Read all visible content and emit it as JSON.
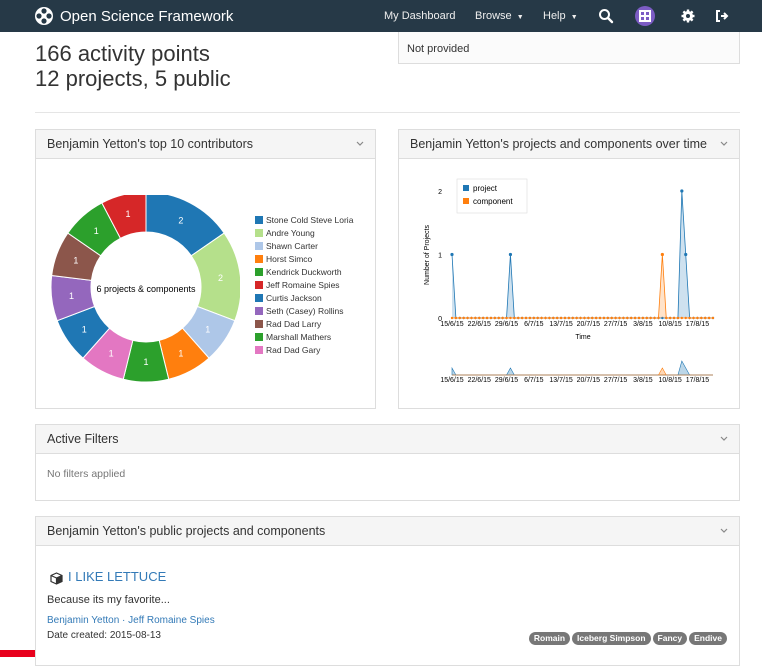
{
  "navbar": {
    "brand": "Open Science Framework",
    "dashboard": "My Dashboard",
    "browse": "Browse",
    "help": "Help"
  },
  "stats": {
    "activity": "166 activity points",
    "projects": "12 projects, 5 public"
  },
  "top_right_value": "Not provided",
  "contributors_panel": {
    "title": "Benjamin Yetton's top 10 contributors",
    "center_label": "6 projects & components"
  },
  "timeline_panel": {
    "title": "Benjamin Yetton's projects and components over time"
  },
  "filters_panel": {
    "title": "Active Filters",
    "empty_text": "No filters applied"
  },
  "public_panel": {
    "title": "Benjamin Yetton's public projects and components"
  },
  "project": {
    "title": "I LIKE LETTUCE",
    "description": "Because its my favorite...",
    "contributors": "Benjamin Yetton · Jeff Romaine Spies",
    "date": "Date created: 2015-08-13",
    "tags": [
      "Romain",
      "Iceberg Simpson",
      "Fancy",
      "Endive"
    ]
  },
  "chart_data": [
    {
      "type": "pie",
      "subtype": "donut",
      "center_label": "6 projects & components",
      "legend_placement": "right",
      "slices": [
        {
          "label": "Stone Cold Steve Loria",
          "value": 2,
          "color": "#1f77b4"
        },
        {
          "label": "Andre Young",
          "value": 2,
          "color": "#aec7e8"
        },
        {
          "label": "Shawn Carter",
          "value": 1,
          "color": "#aec7e8"
        },
        {
          "label": "Horst Simco",
          "value": 1,
          "color": "#ff7f0e"
        },
        {
          "label": "Kendrick Duckworth",
          "value": 1,
          "color": "#2ca02c"
        },
        {
          "label": "Jeff Romaine Spies",
          "value": 1,
          "color": "#d62728"
        },
        {
          "label": "Curtis Jackson",
          "value": 1,
          "color": "#1f77b4"
        },
        {
          "label": "Seth (Casey) Rollins",
          "value": 1,
          "color": "#9467bd"
        },
        {
          "label": "Rad Dad Larry",
          "value": 1,
          "color": "#8c564b"
        },
        {
          "label": "Marshall Mathers",
          "value": 1,
          "color": "#2ca02c"
        },
        {
          "label": "Rad Dad Gary",
          "value": 1,
          "color": "#e377c2"
        }
      ],
      "legend_colors": [
        "#1f77b4",
        "#b5e08b",
        "#aec7e8",
        "#ff7f0e",
        "#2ca02c",
        "#d62728",
        "#1f77b4",
        "#9467bd",
        "#8c564b",
        "#2ca02c",
        "#e377c2"
      ],
      "ring_colors": [
        "#1f77b4",
        "#b5e08b",
        "#aec7e8",
        "#ff7f0e",
        "#2ca02c",
        "#e377c2",
        "#1f77b4",
        "#9467bd",
        "#8c564b",
        "#2ca02c",
        "#d62728"
      ]
    },
    {
      "type": "area",
      "xlabel": "Time",
      "ylabel": "Number of Projects",
      "ylim": [
        0,
        2
      ],
      "yticks": [
        "0",
        "1",
        "2"
      ],
      "x_ticks": [
        "15/6/15",
        "22/6/15",
        "29/6/15",
        "6/7/15",
        "13/7/15",
        "20/7/15",
        "27/7/15",
        "3/8/15",
        "10/8/15",
        "17/8/15"
      ],
      "x_range": [
        "2015-06-15",
        "2015-08-21"
      ],
      "legend_placement": "top-left",
      "series": [
        {
          "name": "project",
          "color": "#1f77b4",
          "spikes": [
            {
              "date": "2015-06-15",
              "value": 1
            },
            {
              "date": "2015-06-30",
              "value": 1
            },
            {
              "date": "2015-08-13",
              "value": 2
            },
            {
              "date": "2015-08-14",
              "value": 1
            }
          ]
        },
        {
          "name": "component",
          "color": "#ff7f0e",
          "spikes": [
            {
              "date": "2015-08-08",
              "value": 1
            }
          ]
        }
      ]
    }
  ]
}
